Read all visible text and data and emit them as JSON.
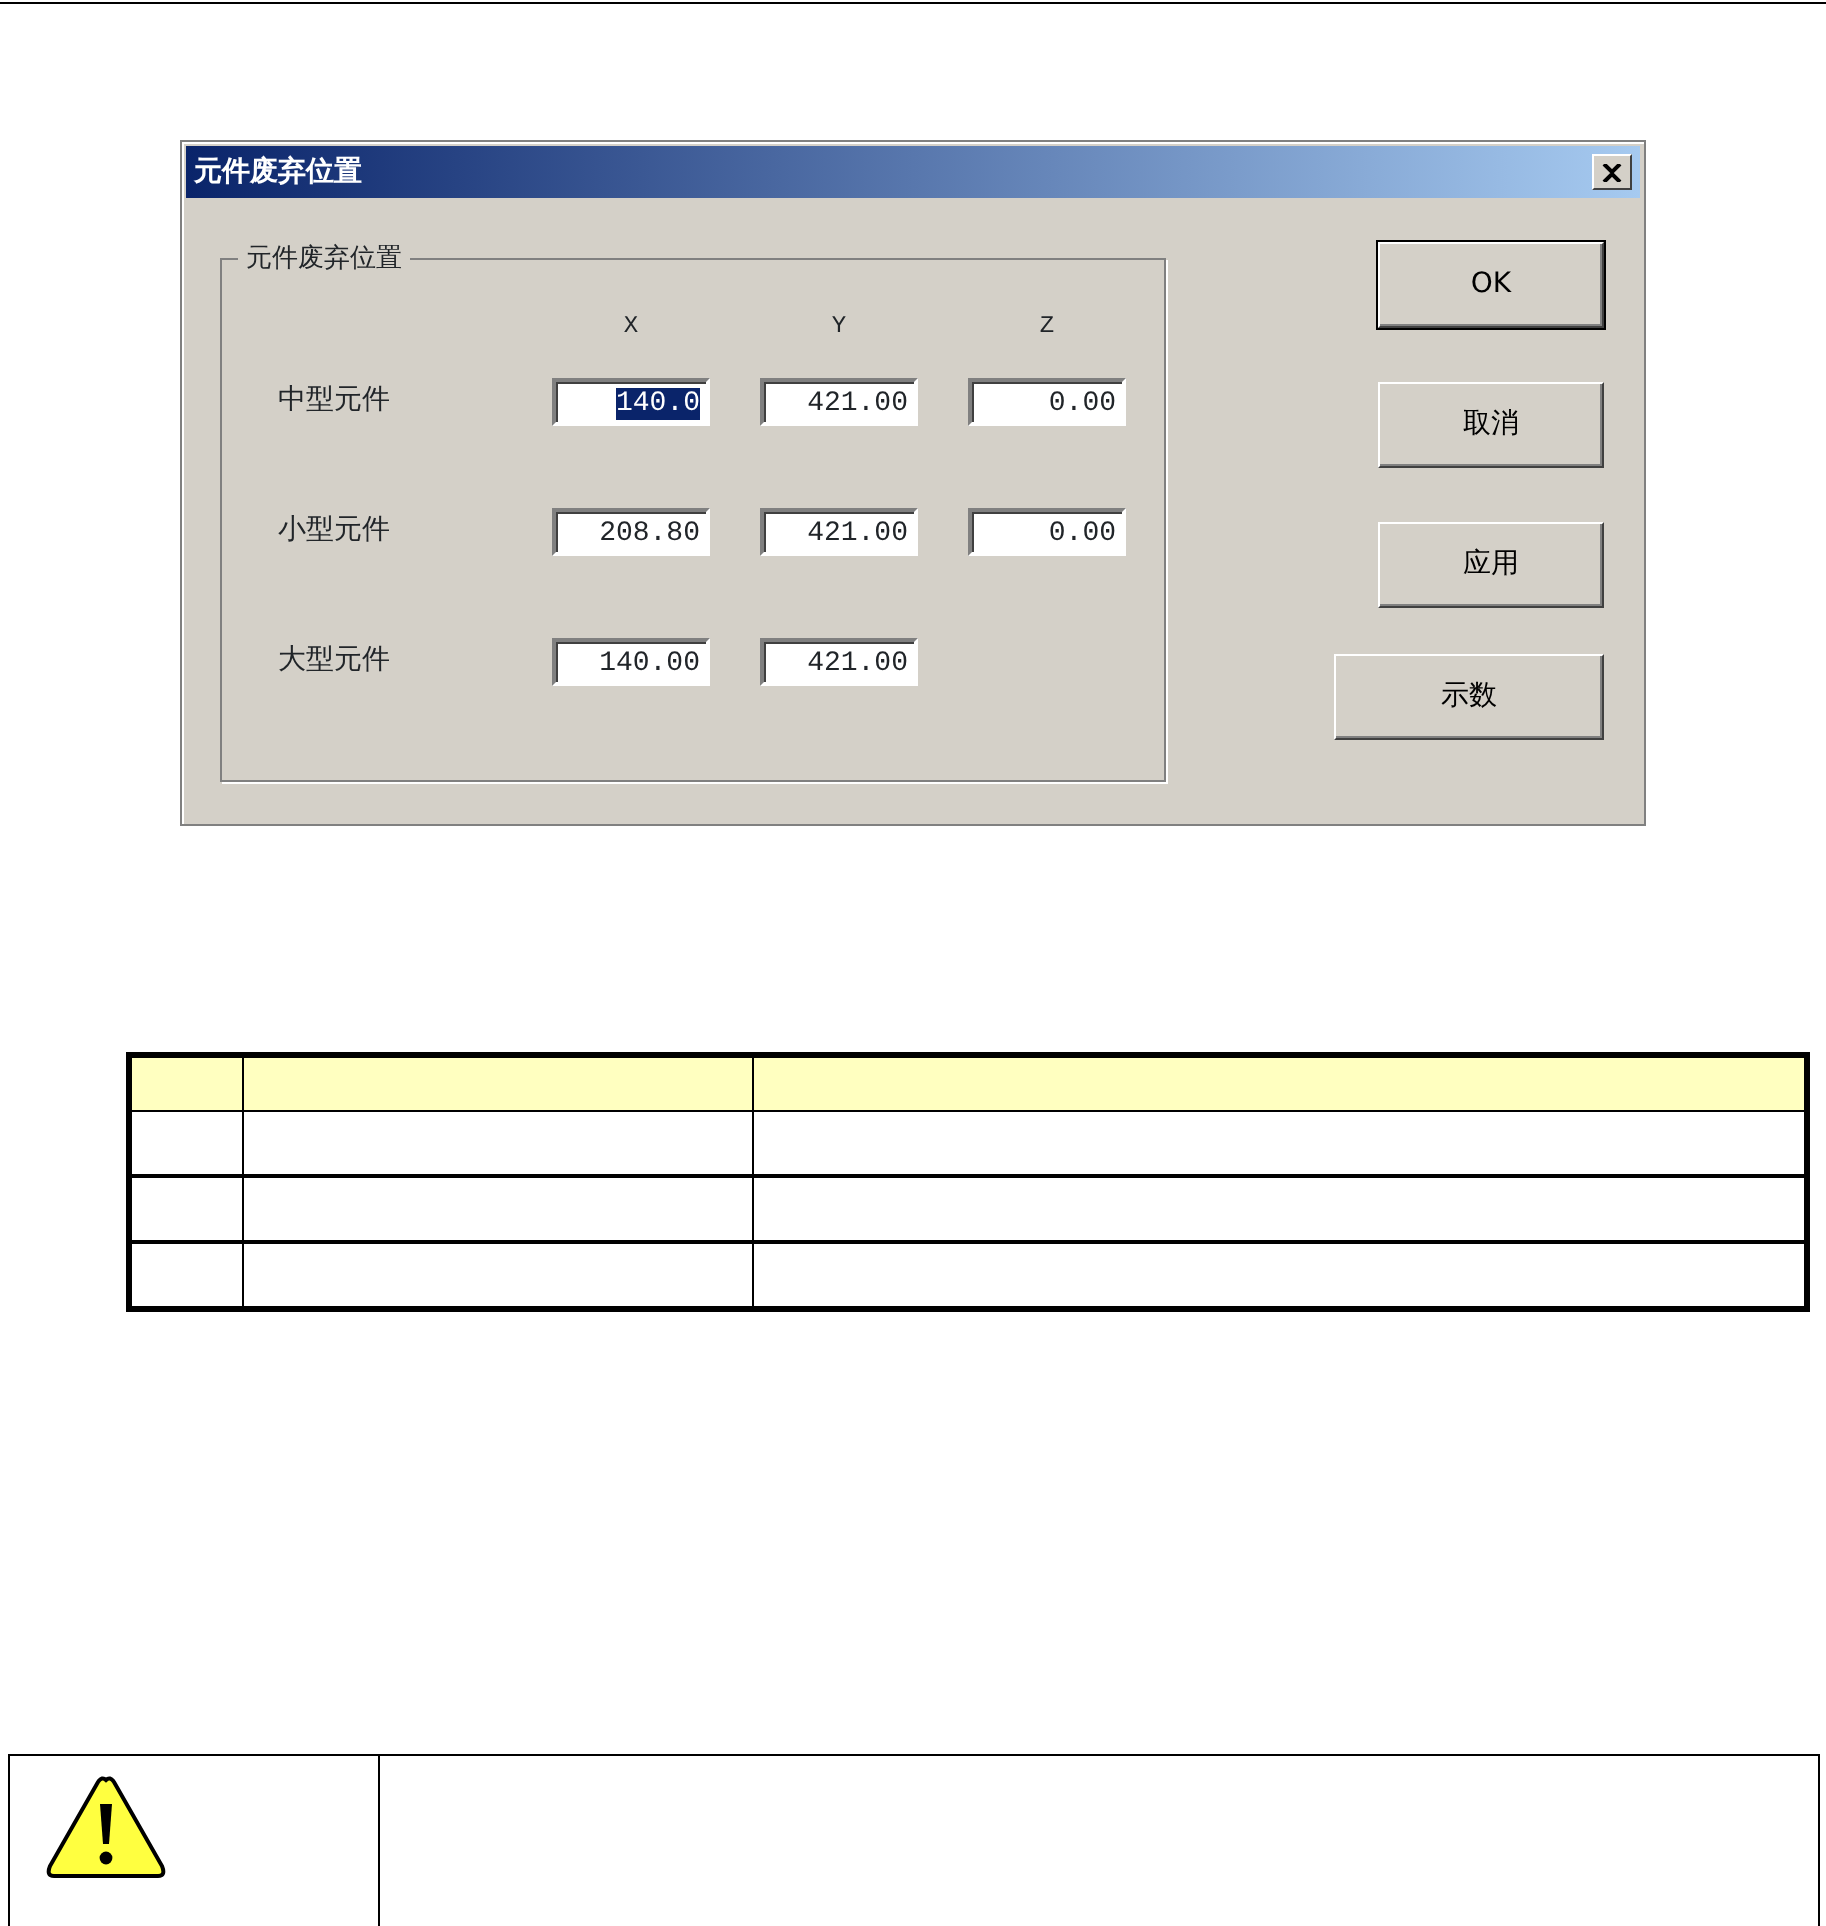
{
  "dialog": {
    "title": "元件废弃位置",
    "group": {
      "label": "元件废弃位置",
      "columns": [
        "X",
        "Y",
        "Z"
      ],
      "rows": [
        {
          "label": "中型元件",
          "fields": [
            {
              "value": "140.0",
              "selected": true
            },
            {
              "value": "421.00",
              "selected": false
            },
            {
              "value": "0.00",
              "selected": false
            }
          ]
        },
        {
          "label": "小型元件",
          "fields": [
            {
              "value": "208.80",
              "selected": false
            },
            {
              "value": "421.00",
              "selected": false
            },
            {
              "value": "0.00",
              "selected": false
            }
          ]
        },
        {
          "label": "大型元件",
          "fields": [
            {
              "value": "140.00",
              "selected": false
            },
            {
              "value": "421.00",
              "selected": false
            }
          ]
        }
      ]
    },
    "buttons": [
      {
        "label": "OK",
        "kind": "default"
      },
      {
        "label": "取消",
        "kind": "normal"
      },
      {
        "label": "应用",
        "kind": "normal"
      },
      {
        "label": "示数",
        "kind": "wide"
      }
    ]
  }
}
